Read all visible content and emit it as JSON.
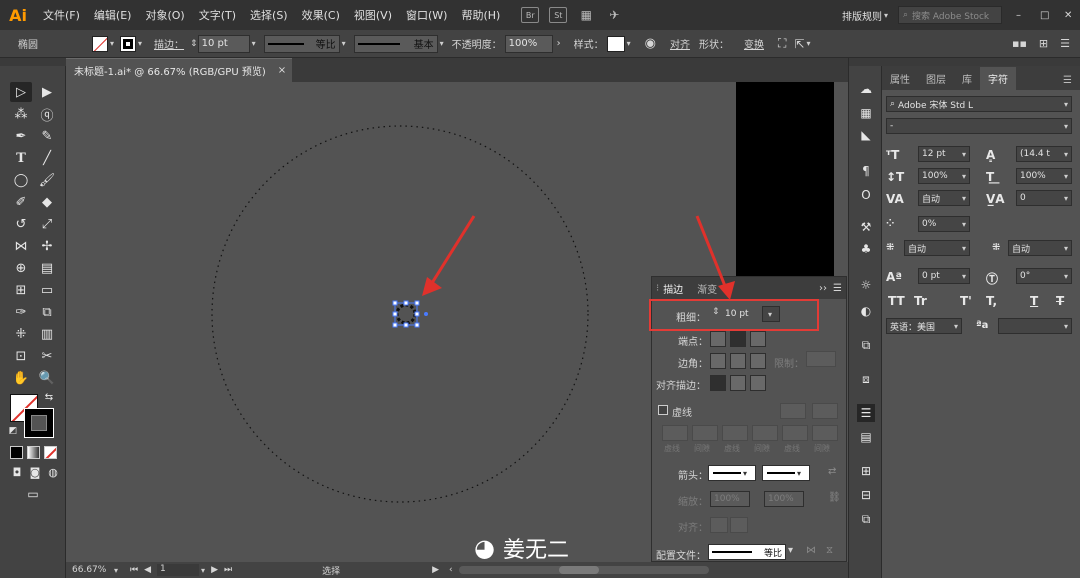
{
  "menubar": {
    "logo": "Ai",
    "items": [
      "文件(F)",
      "编辑(E)",
      "对象(O)",
      "文字(T)",
      "选择(S)",
      "效果(C)",
      "视图(V)",
      "窗口(W)",
      "帮助(H)"
    ],
    "br_icon": "Br",
    "st_icon": "St",
    "workspace": "排版规则",
    "search_placeholder": "搜索 Adobe Stock"
  },
  "controlbar": {
    "object_type": "椭圆",
    "stroke_label": "描边：",
    "stroke_value": "10 pt",
    "stroke_profile": "等比",
    "brush": "基本",
    "opacity_label": "不透明度：",
    "opacity_value": "100%",
    "style_label": "样式：",
    "align_link": "对齐",
    "shape_label": "形状：",
    "transform_link": "变换"
  },
  "document": {
    "tab_title": "未标题-1.ai* @ 66.67% (RGB/GPU 预览)",
    "close_glyph": "×",
    "zoom": "66.67%",
    "page": "1",
    "status": "选择"
  },
  "character_panel": {
    "tabs": [
      "属性",
      "图层",
      "库",
      "字符"
    ],
    "active_tab": "字符",
    "font_family": "Adobe 宋体 Std L",
    "font_style": "-",
    "font_size": "12 pt",
    "leading": "(14.4 t",
    "vertical_scale": "100%",
    "horizontal_scale": "100%",
    "kerning": "自动",
    "tracking": "0",
    "tsume": "0%",
    "aki_left": "自动",
    "aki_right": "自动",
    "baseline_shift": "0 pt",
    "rotation": "0°",
    "language": "英语：美国",
    "caps_buttons": [
      "TT",
      "Tr",
      "T'",
      "T,",
      "T",
      "T"
    ]
  },
  "stroke_panel": {
    "tabs": [
      "描边",
      "渐变"
    ],
    "weight_label": "粗细：",
    "weight_value": "10 pt",
    "cap_label": "端点：",
    "corner_label": "边角：",
    "limit_label": "限制：",
    "align_label": "对齐描边：",
    "dashed_label": "虚线",
    "dash_labels": [
      "虚线",
      "间隙",
      "虚线",
      "间隙",
      "虚线",
      "间隙"
    ],
    "arrow_label": "箭头：",
    "scale_label": "缩放：",
    "scale_values": [
      "100%",
      "100%"
    ],
    "align_arrow_label": "对齐：",
    "profile_label": "配置文件：",
    "profile_value": "等比"
  },
  "watermark": "姜无二",
  "colors": {
    "annotation_red": "#e0312b",
    "highlight_box": "#e33b36",
    "accent": "#ff9a00"
  }
}
